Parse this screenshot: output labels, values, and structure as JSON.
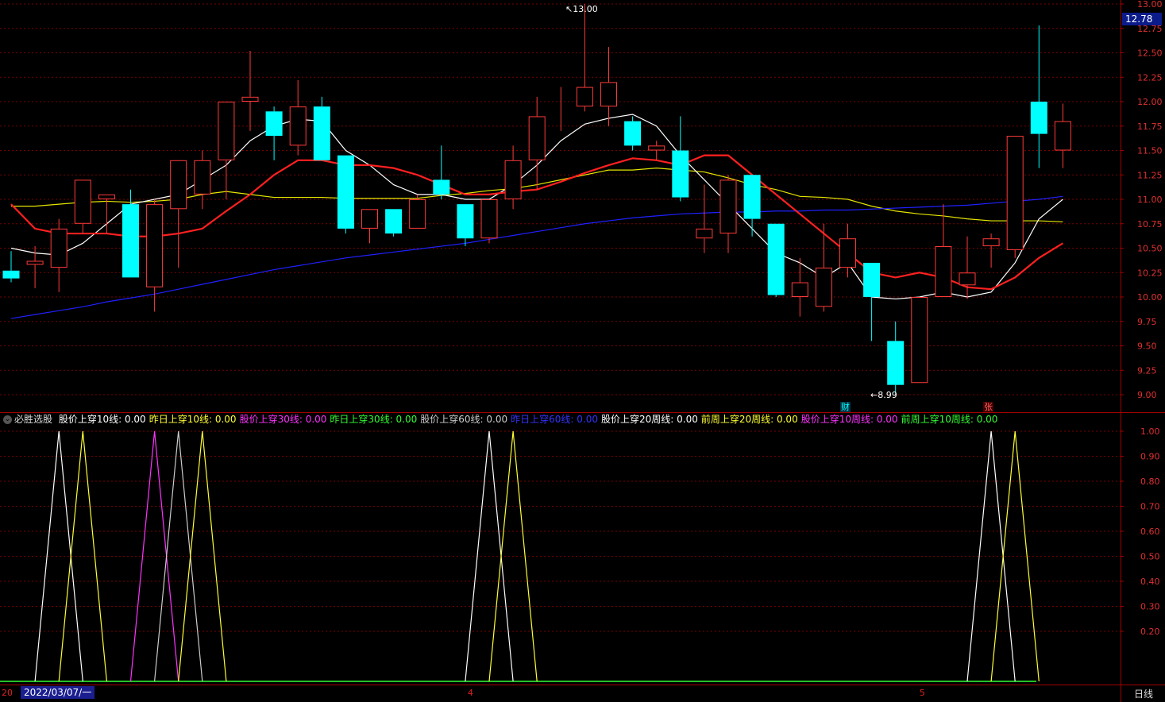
{
  "indicator": {
    "name": "必胜选股",
    "items": [
      {
        "label": "股价上穿10线: 0.00",
        "color": "#ffffff"
      },
      {
        "label": "昨日上穿10线: 0.00",
        "color": "#ffff33"
      },
      {
        "label": "股价上穿30线: 0.00",
        "color": "#ff33ff"
      },
      {
        "label": "昨日上穿30线: 0.00",
        "color": "#33ff33"
      },
      {
        "label": "股价上穿60线: 0.00",
        "color": "#cccccc"
      },
      {
        "label": "昨日上穿60线: 0.00",
        "color": "#3333ff"
      },
      {
        "label": "股价上穿20周线: 0.00",
        "color": "#ffffff"
      },
      {
        "label": "前周上穿20周线: 0.00",
        "color": "#ffff33"
      },
      {
        "label": "股价上穿10周线: 0.00",
        "color": "#ff33ff"
      },
      {
        "label": "前周上穿10周线: 0.00",
        "color": "#33ff33"
      }
    ]
  },
  "current_price": "12.78",
  "cursor_date": "2022/03/07/一",
  "period": "日线",
  "x_ticks": [
    {
      "label": "20",
      "day": 0
    },
    {
      "label": "4",
      "day": 19.5
    },
    {
      "label": "5",
      "day": 38.4
    }
  ],
  "markers": {
    "high_label": "13.00",
    "low_label": "8.99",
    "cai": "财",
    "zhang": "张"
  },
  "colors": {
    "up": "#ff3a3a",
    "down": "#00ffff",
    "ma_white": "#ffffff",
    "ma_red": "#ff2020",
    "ma_yellow": "#e6e600",
    "ma_blue": "#2020ff",
    "axis": "#a00000",
    "grid": "#7a0000"
  },
  "chart_data": {
    "type": "candlestick",
    "price_axis": {
      "ylim": [
        8.9,
        13.0
      ],
      "ticks": [
        "13.00",
        "12.75",
        "12.50",
        "12.25",
        "12.00",
        "11.75",
        "11.50",
        "11.25",
        "11.00",
        "10.75",
        "10.50",
        "10.25",
        "10.00",
        "9.75",
        "9.50",
        "9.25",
        "9.00"
      ]
    },
    "candles": [
      {
        "o": 10.27,
        "h": 10.47,
        "l": 10.15,
        "c": 10.19
      },
      {
        "o": 10.33,
        "h": 10.52,
        "l": 10.09,
        "c": 10.37
      },
      {
        "o": 10.3,
        "h": 10.8,
        "l": 10.05,
        "c": 10.7
      },
      {
        "o": 10.75,
        "h": 11.2,
        "l": 10.65,
        "c": 11.2
      },
      {
        "o": 11.0,
        "h": 11.05,
        "l": 10.65,
        "c": 11.05
      },
      {
        "o": 10.95,
        "h": 11.1,
        "l": 10.2,
        "c": 10.2
      },
      {
        "o": 10.1,
        "h": 11.0,
        "l": 9.85,
        "c": 10.95
      },
      {
        "o": 10.9,
        "h": 11.35,
        "l": 10.3,
        "c": 11.4
      },
      {
        "o": 11.05,
        "h": 11.5,
        "l": 10.9,
        "c": 11.4
      },
      {
        "o": 11.4,
        "h": 12.0,
        "l": 11.0,
        "c": 12.0
      },
      {
        "o": 12.0,
        "h": 12.52,
        "l": 11.7,
        "c": 12.05
      },
      {
        "o": 11.9,
        "h": 11.95,
        "l": 11.4,
        "c": 11.65
      },
      {
        "o": 11.55,
        "h": 12.22,
        "l": 11.45,
        "c": 11.95
      },
      {
        "o": 11.95,
        "h": 12.05,
        "l": 11.4,
        "c": 11.4
      },
      {
        "o": 11.45,
        "h": 11.45,
        "l": 10.65,
        "c": 10.7
      },
      {
        "o": 10.7,
        "h": 10.9,
        "l": 10.55,
        "c": 10.9
      },
      {
        "o": 10.9,
        "h": 10.9,
        "l": 10.62,
        "c": 10.65
      },
      {
        "o": 10.7,
        "h": 11.05,
        "l": 10.7,
        "c": 11.0
      },
      {
        "o": 11.2,
        "h": 11.55,
        "l": 11.0,
        "c": 11.05
      },
      {
        "o": 10.95,
        "h": 10.95,
        "l": 10.52,
        "c": 10.6
      },
      {
        "o": 10.6,
        "h": 11.0,
        "l": 10.55,
        "c": 11.0
      },
      {
        "o": 11.0,
        "h": 11.55,
        "l": 10.9,
        "c": 11.4
      },
      {
        "o": 11.4,
        "h": 12.05,
        "l": 11.1,
        "c": 11.85
      },
      {
        "o": 11.85,
        "h": 12.15,
        "l": 11.7,
        "c": 11.85
      },
      {
        "o": 11.95,
        "h": 13.0,
        "l": 11.9,
        "c": 12.15
      },
      {
        "o": 11.95,
        "h": 12.56,
        "l": 11.75,
        "c": 12.2
      },
      {
        "o": 11.8,
        "h": 11.85,
        "l": 11.5,
        "c": 11.55
      },
      {
        "o": 11.5,
        "h": 11.6,
        "l": 11.4,
        "c": 11.55
      },
      {
        "o": 11.5,
        "h": 11.85,
        "l": 10.98,
        "c": 11.02
      },
      {
        "o": 10.6,
        "h": 11.15,
        "l": 10.45,
        "c": 10.7
      },
      {
        "o": 10.65,
        "h": 11.25,
        "l": 10.45,
        "c": 11.2
      },
      {
        "o": 11.25,
        "h": 11.25,
        "l": 10.62,
        "c": 10.8
      },
      {
        "o": 10.75,
        "h": 10.75,
        "l": 10.0,
        "c": 10.02
      },
      {
        "o": 10.0,
        "h": 10.4,
        "l": 9.8,
        "c": 10.15
      },
      {
        "o": 9.9,
        "h": 10.75,
        "l": 9.85,
        "c": 10.3
      },
      {
        "o": 10.3,
        "h": 10.75,
        "l": 10.2,
        "c": 10.6
      },
      {
        "o": 10.35,
        "h": 10.35,
        "l": 9.55,
        "c": 10.0
      },
      {
        "o": 9.55,
        "h": 9.75,
        "l": 8.99,
        "c": 9.1
      },
      {
        "o": 9.12,
        "h": 10.0,
        "l": 9.12,
        "c": 10.0
      },
      {
        "o": 10.0,
        "h": 10.95,
        "l": 10.0,
        "c": 10.52
      },
      {
        "o": 10.12,
        "h": 10.62,
        "l": 9.98,
        "c": 10.25
      },
      {
        "o": 10.52,
        "h": 10.65,
        "l": 10.3,
        "c": 10.6
      },
      {
        "o": 10.48,
        "h": 11.65,
        "l": 10.4,
        "c": 11.65
      },
      {
        "o": 12.0,
        "h": 12.78,
        "l": 11.32,
        "c": 11.67
      },
      {
        "o": 11.5,
        "h": 11.98,
        "l": 11.32,
        "c": 11.8
      }
    ],
    "ma_white": [
      10.5,
      10.45,
      10.43,
      10.55,
      10.75,
      10.95,
      11.0,
      11.05,
      11.2,
      11.35,
      11.6,
      11.75,
      11.82,
      11.8,
      11.5,
      11.35,
      11.15,
      11.05,
      11.05,
      11.0,
      11.0,
      11.15,
      11.35,
      11.6,
      11.77,
      11.83,
      11.87,
      11.75,
      11.45,
      11.2,
      10.95,
      10.7,
      10.45,
      10.35,
      10.2,
      10.35,
      10.0,
      9.98,
      10.0,
      10.05,
      10.0,
      10.05,
      10.35,
      10.8,
      11.0
    ],
    "ma_red": [
      10.95,
      10.7,
      10.65,
      10.65,
      10.65,
      10.62,
      10.62,
      10.65,
      10.7,
      10.88,
      11.05,
      11.25,
      11.4,
      11.4,
      11.35,
      11.35,
      11.32,
      11.25,
      11.15,
      11.05,
      11.05,
      11.08,
      11.1,
      11.18,
      11.27,
      11.35,
      11.42,
      11.4,
      11.35,
      11.45,
      11.45,
      11.25,
      11.05,
      10.85,
      10.65,
      10.45,
      10.25,
      10.2,
      10.25,
      10.2,
      10.1,
      10.08,
      10.2,
      10.4,
      10.55
    ],
    "ma_yellow": [
      10.93,
      10.93,
      10.95,
      10.97,
      10.98,
      10.97,
      10.98,
      11.0,
      11.05,
      11.08,
      11.05,
      11.02,
      11.02,
      11.02,
      11.01,
      11.01,
      11.01,
      11.01,
      11.04,
      11.06,
      11.09,
      11.11,
      11.15,
      11.2,
      11.25,
      11.3,
      11.3,
      11.32,
      11.3,
      11.28,
      11.22,
      11.15,
      11.1,
      11.03,
      11.02,
      11.0,
      10.93,
      10.88,
      10.85,
      10.83,
      10.8,
      10.78,
      10.78,
      10.78,
      10.77
    ],
    "ma_blue": [
      9.78,
      9.82,
      9.86,
      9.9,
      9.95,
      9.99,
      10.03,
      10.08,
      10.13,
      10.18,
      10.23,
      10.28,
      10.32,
      10.36,
      10.4,
      10.43,
      10.46,
      10.49,
      10.52,
      10.55,
      10.59,
      10.63,
      10.67,
      10.71,
      10.75,
      10.78,
      10.81,
      10.83,
      10.85,
      10.86,
      10.87,
      10.87,
      10.88,
      10.88,
      10.89,
      10.89,
      10.9,
      10.91,
      10.92,
      10.93,
      10.94,
      10.96,
      10.98,
      11.0,
      11.03
    ],
    "indicator_axis": {
      "ylim": [
        0,
        1.0
      ],
      "ticks": [
        "1.00",
        "0.90",
        "0.80",
        "0.70",
        "0.60",
        "0.50",
        "0.40",
        "0.30",
        "0.20"
      ]
    },
    "signals": [
      {
        "name": "股价上穿10线",
        "color": "#ffffff",
        "days": [
          2,
          20,
          41
        ]
      },
      {
        "name": "昨日上穿10线",
        "color": "#ffff33",
        "days": [
          3,
          21,
          42
        ]
      },
      {
        "name": "股价上穿30线",
        "color": "#ff33ff",
        "days": [
          6
        ]
      },
      {
        "name": "昨日上穿30线",
        "color": "#33ff33",
        "days": []
      },
      {
        "name": "股价上穿60线",
        "color": "#cccccc",
        "days": [
          7
        ]
      },
      {
        "name": "昨日上穿60线",
        "color": "#3333ff",
        "days": []
      },
      {
        "name": "股价上穿20周线",
        "color": "#ffffff",
        "days": []
      },
      {
        "name": "前周上穿20周线",
        "color": "#ffff33",
        "days": [
          8
        ]
      },
      {
        "name": "股价上穿10周线",
        "color": "#ff33ff",
        "days": []
      },
      {
        "name": "前周上穿10周线",
        "color": "#33ff33",
        "days": []
      }
    ]
  }
}
